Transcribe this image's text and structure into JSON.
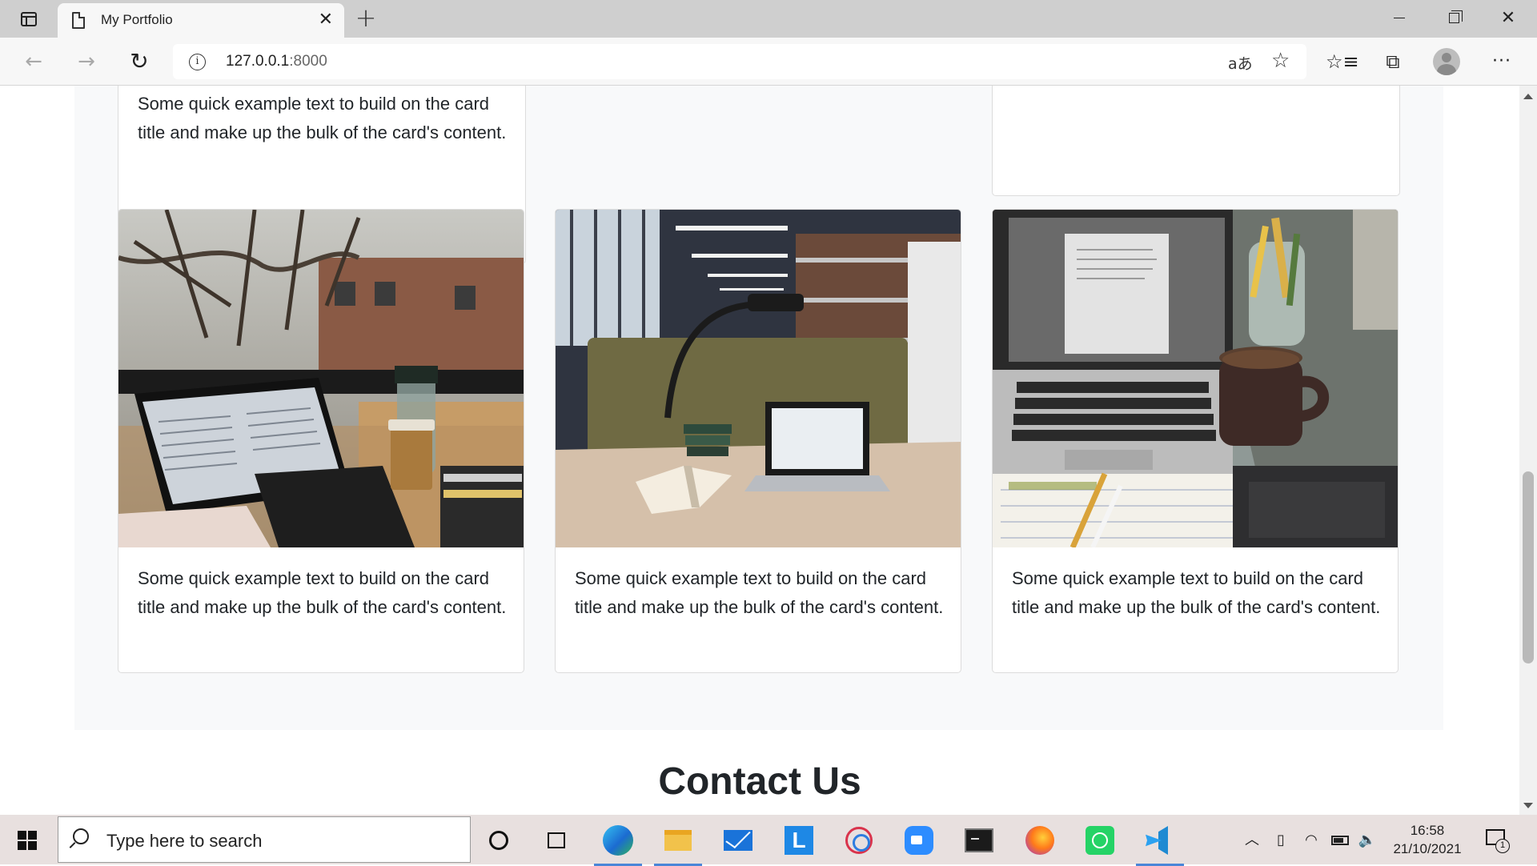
{
  "browser": {
    "tab_title": "My Portfolio",
    "tab_close": "✕",
    "new_tab": "+",
    "url_host": "127.0.0.1",
    "url_port": ":8000",
    "back_glyph": "←",
    "forward_glyph": "→",
    "reload_glyph": "↻",
    "translate_glyph": "aあ",
    "fav_add_glyph": "☆",
    "favorites_glyph": "☆≡",
    "collections_glyph": "⧉",
    "more_glyph": "···",
    "close_window_glyph": "✕",
    "icons": [
      "sidebar-icon",
      "page-icon",
      "info-icon",
      "translate-icon",
      "add-favorite-icon",
      "favorites-icon",
      "collections-icon",
      "profile-icon",
      "more-icon"
    ]
  },
  "page": {
    "top_card_text": "Some quick example text to build on the card title and make up the bulk of the card's content.",
    "cards": [
      {
        "text": "Some quick example text to build on the card title and make up the bulk of the card's content.",
        "image": "laptop-window-trees-photo"
      },
      {
        "text": "Some quick example text to build on the card title and make up the bulk of the card's content.",
        "image": "library-desk-laptop-photo"
      },
      {
        "text": "Some quick example text to build on the card title and make up the bulk of the card's content.",
        "image": "laptop-coffee-mug-photo"
      }
    ],
    "contact_heading": "Contact Us"
  },
  "taskbar": {
    "search_placeholder": "Type here to search",
    "apps": [
      "edge",
      "file-explorer",
      "mail",
      "l-app",
      "snip-sketch",
      "zoom",
      "terminal",
      "firefox",
      "whatsapp",
      "vscode"
    ],
    "tray_chevron": "︿",
    "tray_meet": "▯",
    "tray_wifi": "◠",
    "tray_volume": "🔈",
    "time": "16:58",
    "date": "21/10/2021",
    "notification_count": "1"
  },
  "colors": {
    "section_background": "#f8f9fa",
    "taskbar_background": "#e8e0df",
    "active_indicator": "#4a86d8"
  }
}
